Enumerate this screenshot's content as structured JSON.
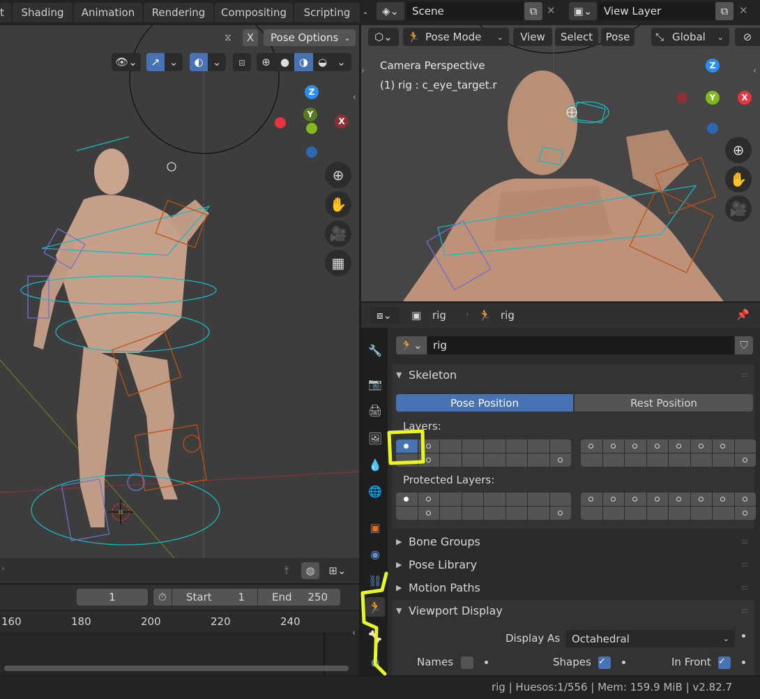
{
  "workspace_tabs": [
    "t",
    "Shading",
    "Animation",
    "Rendering",
    "Compositing",
    "Scripting",
    "-"
  ],
  "scene": {
    "name": "Scene",
    "view_layer": "View Layer"
  },
  "left_viewport": {
    "pose_options_label": "Pose Options",
    "x_label": "X",
    "timeline_header": {
      "current_frame": "1",
      "start_label": "Start",
      "start_value": "1",
      "end_label": "End",
      "end_value": "250"
    },
    "timeline_ruler": [
      "160",
      "180",
      "200",
      "220",
      "240"
    ]
  },
  "right_viewport": {
    "mode": "Pose Mode",
    "menus": [
      "View",
      "Select",
      "Pose"
    ],
    "orientation": "Global",
    "overlay_line1": "Camera Perspective",
    "overlay_line2": "(1) rig : c_eye_target.r"
  },
  "gizmo": {
    "z": "Z",
    "y": "Y",
    "x": "X"
  },
  "properties": {
    "breadcrumb_object": "rig",
    "breadcrumb_data": "rig",
    "data_name": "rig",
    "skeleton": {
      "title": "Skeleton",
      "pose_position": "Pose Position",
      "rest_position": "Rest Position",
      "layers_label": "Layers:",
      "protected_layers_label": "Protected Layers:"
    },
    "collapsed_panels": [
      "Bone Groups",
      "Pose Library",
      "Motion Paths"
    ],
    "viewport_display": {
      "title": "Viewport Display",
      "display_as_label": "Display As",
      "display_as_value": "Octahedral",
      "names_label": "Names",
      "names_checked": false,
      "shapes_label": "Shapes",
      "shapes_checked": true,
      "in_front_label": "In Front",
      "in_front_checked": true
    }
  },
  "status_bar": "rig | Huesos:1/556 | Mem: 159.9 MiB | v2.82.7",
  "colors": {
    "accent": "#4772b3",
    "highlight": "#e8f526",
    "x_axis": "#e5333f",
    "y_axis": "#7fb81f",
    "z_axis": "#2c8ff0"
  }
}
